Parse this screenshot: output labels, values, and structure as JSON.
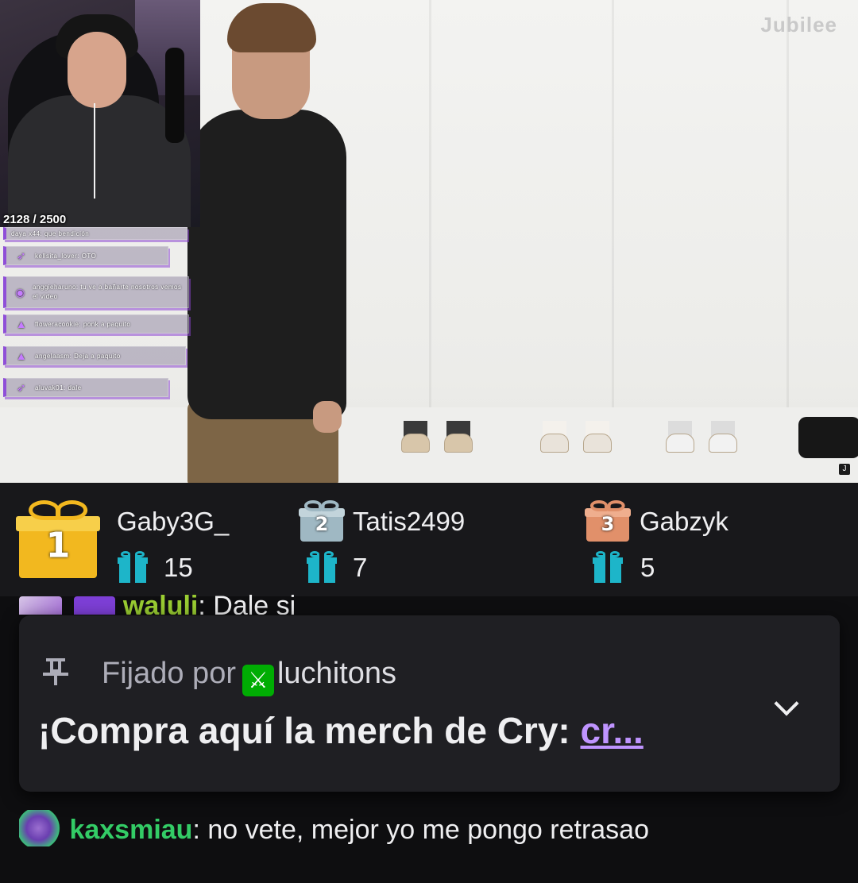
{
  "stream": {
    "watermark": "Jubilee",
    "yt_badge": "J",
    "webcam_counter": "2128 / 2500",
    "overlay_chat": [
      {
        "user": "daya x44",
        "text": "que bendición"
      },
      {
        "user": "kellsita_lover",
        "text": "OTO"
      },
      {
        "user": "anggieharuno",
        "text": "tu ve a bañarte nosotros vemos el video"
      },
      {
        "user": "floweracookie",
        "text": "ponk a paquito"
      },
      {
        "user": "angelaasm",
        "text": "Deja a paquito"
      },
      {
        "user": "aluvak01",
        "text": "dale"
      }
    ]
  },
  "leaderboard": {
    "entries": [
      {
        "rank": "1",
        "name": "Gaby3G_",
        "count": "15",
        "color": "#f2b81f"
      },
      {
        "rank": "2",
        "name": "Tatis2499",
        "count": "7",
        "color": "#9fb8c3"
      },
      {
        "rank": "3",
        "name": "Gabzyk",
        "count": "5",
        "color": "#e1906a"
      }
    ],
    "gift_icon_color": "#1db5c9"
  },
  "chat": {
    "partial_message": {
      "user": "waluli",
      "text": "Dale si",
      "user_color": "#9acd32"
    },
    "pinned": {
      "prefix": "Fijado por",
      "pinner": "luchitons",
      "message": "¡Compra aquí la merch de Cry: ",
      "link": "cr...",
      "link_color": "#bf94ff",
      "pin_icon": "pin-icon",
      "expand_icon": "chevron-down-icon"
    },
    "last_message": {
      "user": "kaxsmiau",
      "text": "no vete, mejor yo me pongo retrasao",
      "user_color": "#33cc66"
    }
  }
}
